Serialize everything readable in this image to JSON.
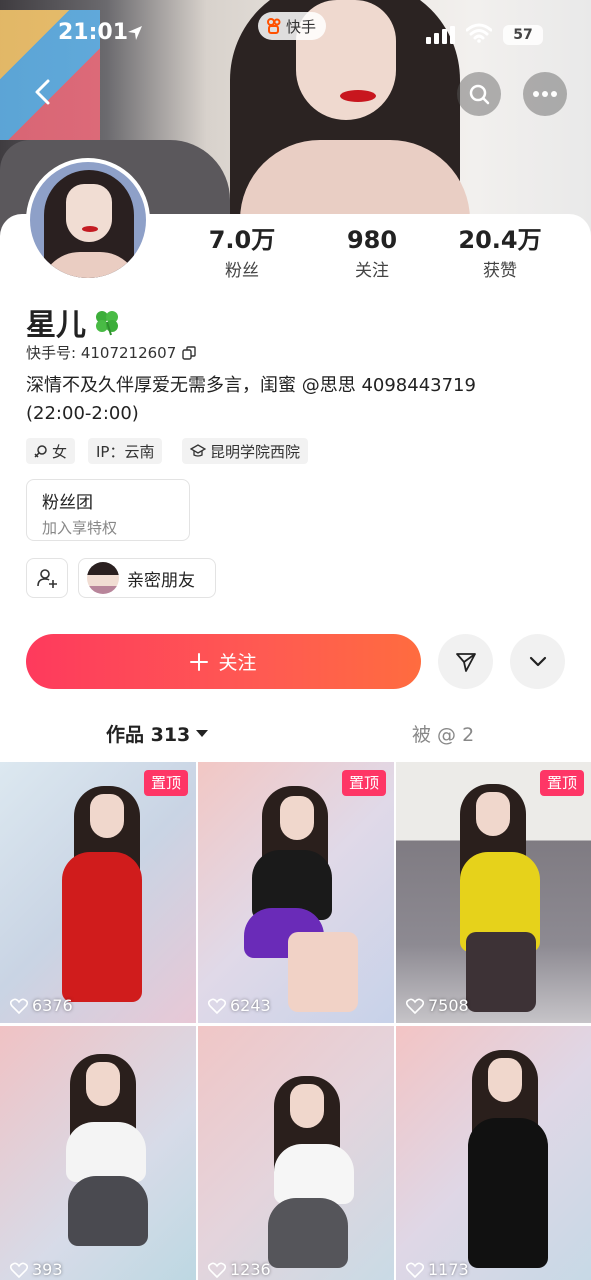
{
  "status_bar": {
    "time": "21:01",
    "battery": "57"
  },
  "app_badge": {
    "label": "快手"
  },
  "profile": {
    "nickname": "星儿",
    "kuaishou_id_label": "快手号: 4107212607",
    "bio_line1": "深情不及久伴厚爱无需多言，闺蜜 @思思 4098443719",
    "bio_line2": "(22:00-2:00)",
    "tags": [
      "女",
      "IP：云南",
      "昆明学院西院"
    ]
  },
  "stats": [
    {
      "value": "7.0万",
      "label": "粉丝"
    },
    {
      "value": "980",
      "label": "关注"
    },
    {
      "value": "20.4万",
      "label": "获赞"
    }
  ],
  "fan_club": {
    "title": "粉丝团",
    "subtitle": "加入享特权"
  },
  "close_friend": {
    "label": "亲密朋友"
  },
  "actions": {
    "follow_label": "关注"
  },
  "tabs": {
    "works": "作品 313",
    "mentions": "被 @ 2"
  },
  "videos": [
    {
      "likes": "6376",
      "pinned": true,
      "pin_label": "置顶"
    },
    {
      "likes": "6243",
      "pinned": true,
      "pin_label": "置顶"
    },
    {
      "likes": "7508",
      "pinned": true,
      "pin_label": "置顶"
    },
    {
      "likes": "393",
      "pinned": false
    },
    {
      "likes": "1236",
      "pinned": false
    },
    {
      "likes": "1173",
      "pinned": false
    }
  ],
  "colors": {
    "accent": "#fe3a5d",
    "accent_end": "#ff6c3f",
    "pin_badge": "#fe3666"
  }
}
